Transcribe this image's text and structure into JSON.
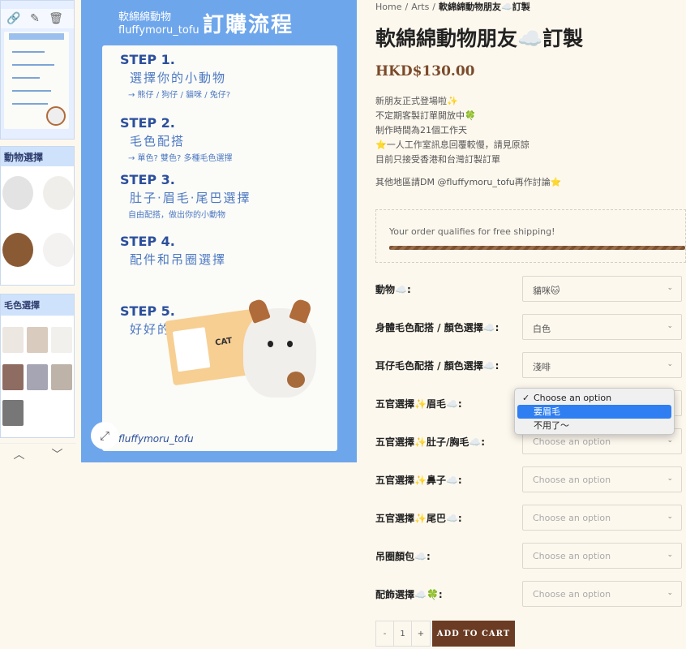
{
  "breadcrumb": {
    "home": "Home",
    "category": "Arts",
    "current": "軟綿綿動物朋友☁️訂製"
  },
  "product": {
    "title": "軟綿綿動物朋友☁️訂製",
    "price": "HKD$130.00",
    "description": [
      "新朋友正式登場啦✨",
      "不定期客製訂單開放中🍀",
      "制作時間為21個工作天",
      "⭐️一人工作室訊息回覆較慢，請見原諒",
      "目前只接受香港和台灣訂製訂單"
    ],
    "description_extra": "其他地區請DM @fluffymoru_tofu再作討論⭐️"
  },
  "shipping": {
    "text": "Your order qualifies for free shipping!"
  },
  "options": [
    {
      "label": "動物☁️:",
      "value": "貓咪🐱",
      "placeholder": false
    },
    {
      "label": "身體毛色配搭 / 顏色選擇☁️:",
      "value": "白色",
      "placeholder": false
    },
    {
      "label": "耳仔毛色配搭 / 顏色選擇☁️:",
      "value": "淺啡",
      "placeholder": false
    },
    {
      "label": "五官選擇✨眉毛☁️:",
      "value": "",
      "placeholder": false
    },
    {
      "label": "五官選擇✨肚子/胸毛☁️:",
      "value": "Choose an option",
      "placeholder": true
    },
    {
      "label": "五官選擇✨鼻子☁️:",
      "value": "Choose an option",
      "placeholder": true
    },
    {
      "label": "五官選擇✨尾巴☁️:",
      "value": "Choose an option",
      "placeholder": true
    },
    {
      "label": "吊圈顏包☁️:",
      "value": "Choose an option",
      "placeholder": true
    },
    {
      "label": "配飾選擇☁️🍀:",
      "value": "Choose an option",
      "placeholder": true
    }
  ],
  "dropdown": {
    "items": [
      "Choose an option",
      "要眉毛",
      "不用了～"
    ],
    "checked_index": 0,
    "highlighted_index": 1,
    "check_mark": "✓"
  },
  "cart": {
    "minus": "-",
    "quantity": "1",
    "plus": "+",
    "add_label": "ADD TO CART"
  },
  "image": {
    "brand_line1": "軟綿綿動物",
    "brand_line2": "fluffymoru_tofu",
    "title": "訂購流程",
    "steps": [
      {
        "label": "STEP 1.",
        "main": "選擇你的小動物",
        "sub": "→ 熊仔 / 狗仔 / 貓咪 / 兔仔?"
      },
      {
        "label": "STEP 2.",
        "main": "毛色配搭",
        "sub": "→ 單色? 雙色? 多種毛色選擇"
      },
      {
        "label": "STEP 3.",
        "main": "肚子·眉毛·尾巴選擇",
        "sub": "自由配搭，做出你的小動物"
      },
      {
        "label": "STEP 4.",
        "main": "配件和吊圈選擇",
        "sub": ""
      },
      {
        "label": "STEP 5.",
        "main": "好好的期待動物回家",
        "sub": ""
      }
    ],
    "card_label": "CAT",
    "footer": "fluffymoru_tofu"
  },
  "thumbs": {
    "thumb2_title": "動物選擇",
    "thumb3_title": "毛色選擇"
  },
  "icons": {
    "link": "🔗",
    "edit": "✎",
    "trash": "🗑",
    "expand": "⤢",
    "chevron_up": "︿",
    "chevron_down": "﹀",
    "select_chevron": "⌄"
  },
  "colors": {
    "accent": "#6b3b23",
    "price": "#7a4a2a",
    "image_bg": "#6ea6ec",
    "highlight": "#2f7ff2"
  }
}
